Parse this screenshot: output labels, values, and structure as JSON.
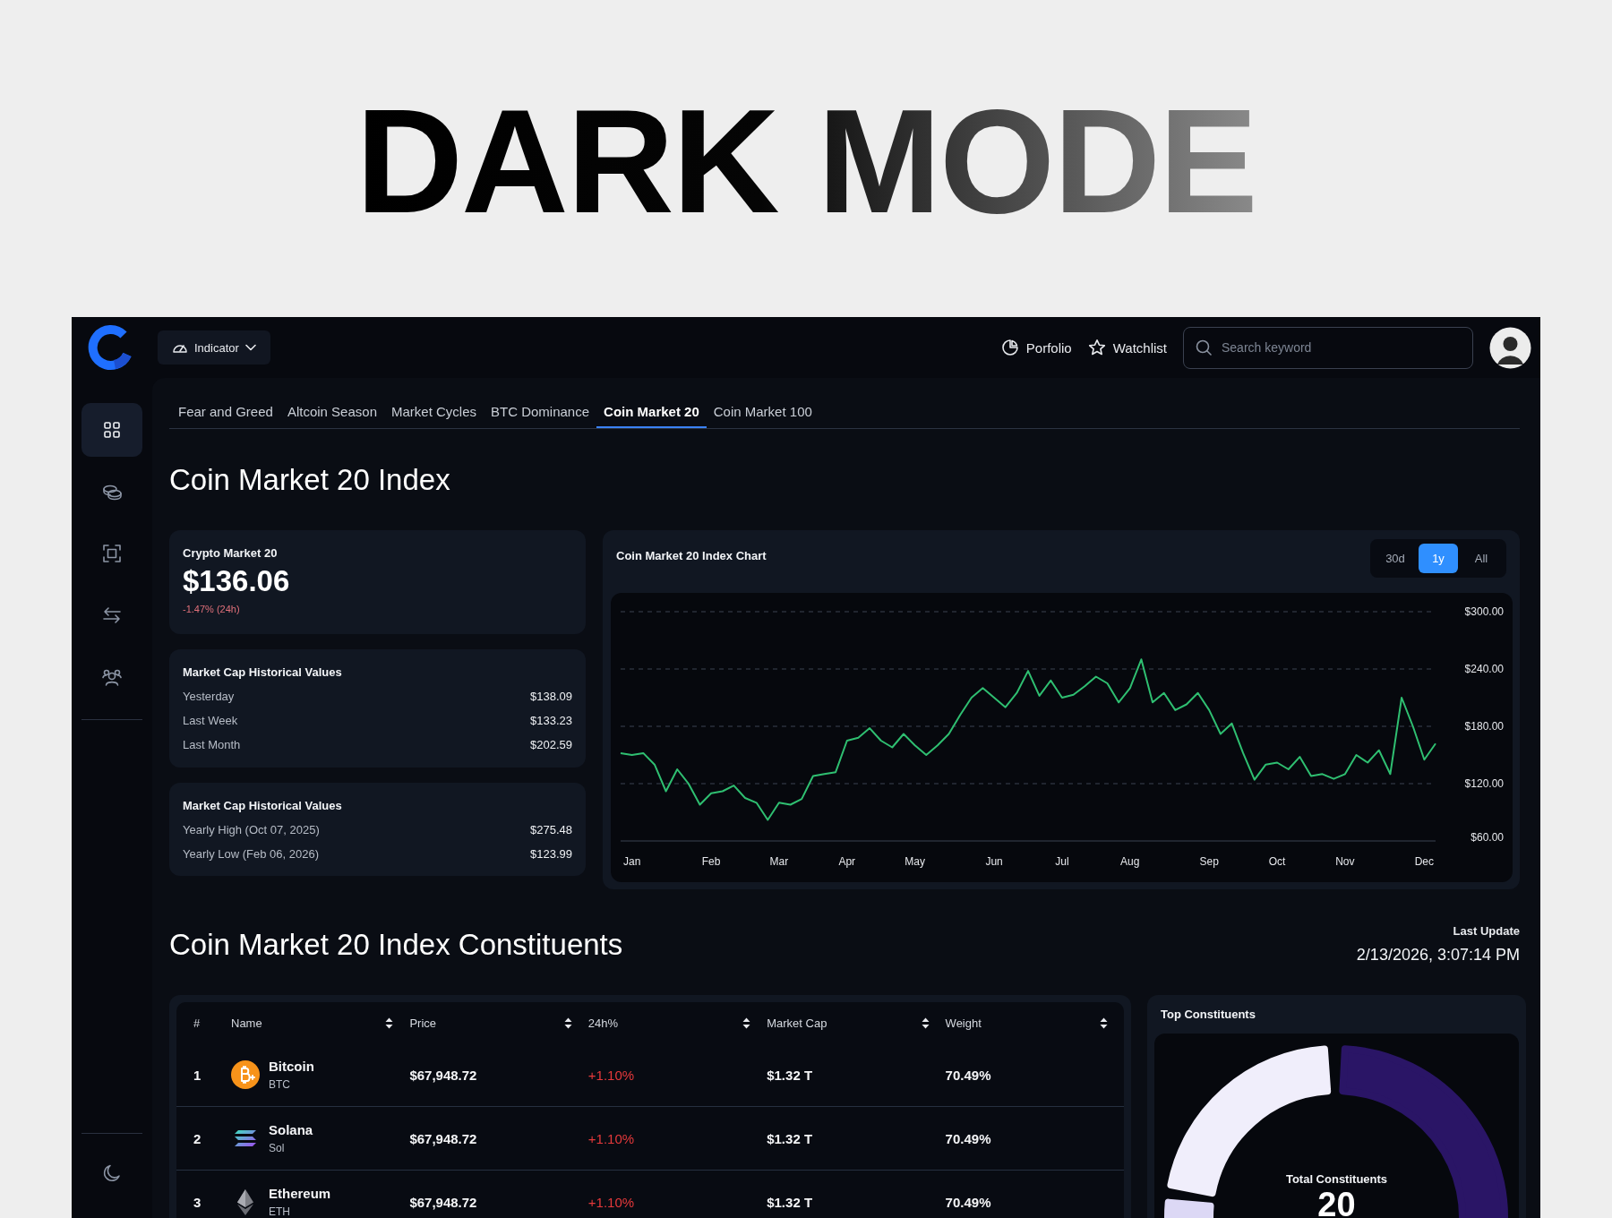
{
  "banner": {
    "title": "DARK MODE"
  },
  "topbar": {
    "indicator": {
      "label": "Indicator"
    },
    "links": [
      {
        "label": "Porfolio"
      },
      {
        "label": "Watchlist"
      }
    ],
    "search": {
      "placeholder": "Search keyword"
    }
  },
  "sidebar": {
    "items": [
      {
        "selected": true
      },
      {
        "selected": false
      },
      {
        "selected": false
      },
      {
        "selected": false
      },
      {
        "selected": false
      }
    ]
  },
  "tabs": [
    {
      "label": "Fear and Greed",
      "selected": false
    },
    {
      "label": "Altcoin Season",
      "selected": false
    },
    {
      "label": "Market Cycles",
      "selected": false
    },
    {
      "label": "BTC Dominance",
      "selected": false
    },
    {
      "label": "Coin Market 20",
      "selected": true
    },
    {
      "label": "Coin Market 100",
      "selected": false
    }
  ],
  "page_title": "Coin Market 20 Index",
  "summary": {
    "title": "Crypto Market 20",
    "value": "$136.06",
    "change": "-1.47% (24h)"
  },
  "history_cards": [
    {
      "title": "Market Cap Historical Values",
      "rows": [
        {
          "label": "Yesterday",
          "value": "$138.09"
        },
        {
          "label": "Last Week",
          "value": "$133.23"
        },
        {
          "label": "Last Month",
          "value": "$202.59"
        }
      ]
    },
    {
      "title": "Market Cap Historical Values",
      "rows": [
        {
          "label": "Yearly High (Oct 07, 2025)",
          "value": "$275.48"
        },
        {
          "label": "Yearly Low (Feb 06, 2026)",
          "value": "$123.99"
        }
      ]
    }
  ],
  "chart": {
    "title": "Coin Market 20 Index Chart",
    "ranges": [
      {
        "label": "30d",
        "selected": false
      },
      {
        "label": "1y",
        "selected": true
      },
      {
        "label": "All",
        "selected": false
      }
    ],
    "chart_data": {
      "type": "line",
      "grid": true,
      "ylim": [
        60,
        300
      ],
      "categories": [
        null,
        "Jan",
        null,
        null,
        null,
        null,
        null,
        null,
        "Feb",
        null,
        null,
        null,
        null,
        null,
        "Mar",
        null,
        null,
        null,
        null,
        null,
        "Apr",
        null,
        null,
        null,
        null,
        null,
        "May",
        null,
        null,
        null,
        null,
        null,
        null,
        "Jun",
        null,
        null,
        null,
        null,
        null,
        "Jul",
        null,
        null,
        null,
        null,
        null,
        "Aug",
        null,
        null,
        null,
        null,
        null,
        null,
        "Sep",
        null,
        null,
        null,
        null,
        null,
        "Oct",
        null,
        null,
        null,
        null,
        null,
        "Nov",
        null,
        null,
        null,
        null,
        null,
        null,
        "Dec",
        null
      ],
      "yticks": [
        {
          "value": 300,
          "label": "$300.00"
        },
        {
          "value": 240,
          "label": "$240.00"
        },
        {
          "value": 180,
          "label": "$180.00"
        },
        {
          "value": 120,
          "label": "$120.00"
        },
        {
          "value": 60,
          "label": "$60.00"
        }
      ],
      "series": [
        {
          "color": "#2fbf71",
          "values": [
            152,
            150,
            152,
            140,
            112,
            135,
            120,
            98,
            110,
            112,
            118,
            105,
            100,
            82,
            100,
            98,
            104,
            128,
            130,
            132,
            165,
            168,
            178,
            165,
            158,
            172,
            160,
            150,
            160,
            172,
            192,
            210,
            220,
            210,
            200,
            215,
            238,
            212,
            228,
            210,
            213,
            222,
            232,
            225,
            205,
            220,
            250,
            205,
            215,
            197,
            203,
            215,
            197,
            172,
            183,
            152,
            124,
            140,
            142,
            135,
            148,
            128,
            130,
            125,
            130,
            150,
            142,
            155,
            130,
            210,
            180,
            145,
            162
          ]
        }
      ]
    }
  },
  "constituents": {
    "title": "Coin Market 20 Index Constituents",
    "last_update_label": "Last Update",
    "last_update": "2/13/2026, 3:07:14 PM",
    "table": {
      "columns": [
        {
          "label": "#",
          "sortable": false
        },
        {
          "label": "Name",
          "sortable": true
        },
        {
          "label": "Price",
          "sortable": true
        },
        {
          "label": "24h%",
          "sortable": true
        },
        {
          "label": "Market Cap",
          "sortable": true
        },
        {
          "label": "Weight",
          "sortable": true
        }
      ],
      "rows": [
        {
          "rank": "1",
          "name": "Bitcoin",
          "symbol": "BTC",
          "price": "$67,948.72",
          "change": "+1.10%",
          "market_cap": "$1.32 T",
          "weight": "70.49%"
        },
        {
          "rank": "2",
          "name": "Solana",
          "symbol": "Sol",
          "price": "$67,948.72",
          "change": "+1.10%",
          "market_cap": "$1.32 T",
          "weight": "70.49%"
        },
        {
          "rank": "3",
          "name": "Ethereum",
          "symbol": "ETH",
          "price": "$67,948.72",
          "change": "+1.10%",
          "market_cap": "$1.32 T",
          "weight": "70.49%"
        }
      ]
    }
  },
  "top_constituents": {
    "title": "Top Constituents",
    "center_label": "Total Constituents",
    "total": "20"
  }
}
